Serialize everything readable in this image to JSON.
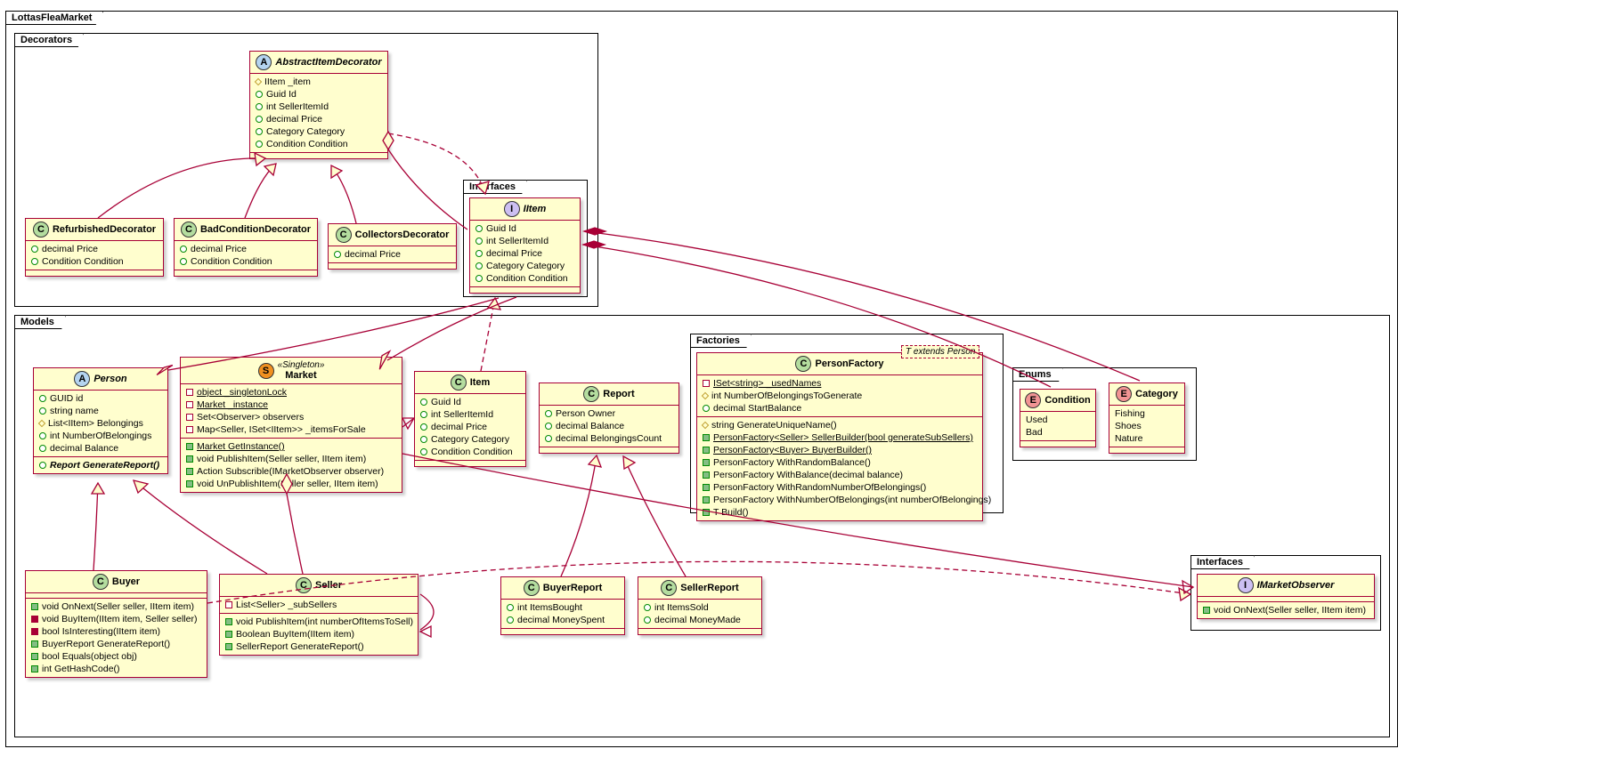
{
  "frames": {
    "root": "LottasFleaMarket",
    "decorators": "Decorators",
    "decInterfaces": "Interfaces",
    "models": "Models",
    "factories": "Factories",
    "enums": "Enums",
    "modInterfaces": "Interfaces"
  },
  "AbstractItemDecorator": {
    "name": "AbstractItemDecorator",
    "m0": "IItem _item",
    "m1": "Guid Id",
    "m2": "int SellerItemId",
    "m3": "decimal Price",
    "m4": "Category Category",
    "m5": "Condition Condition"
  },
  "RefurbishedDecorator": {
    "name": "RefurbishedDecorator",
    "m0": "decimal Price",
    "m1": "Condition Condition"
  },
  "BadConditionDecorator": {
    "name": "BadConditionDecorator",
    "m0": "decimal Price",
    "m1": "Condition Condition"
  },
  "CollectorsDecorator": {
    "name": "CollectorsDecorator",
    "m0": "decimal Price"
  },
  "IItem": {
    "name": "IItem",
    "m0": "Guid Id",
    "m1": "int SellerItemId",
    "m2": "decimal Price",
    "m3": "Category Category",
    "m4": "Condition Condition"
  },
  "Person": {
    "name": "Person",
    "m0": "GUID id",
    "m1": "string name",
    "m2": "List<IItem> Belongings",
    "m3": "int NumberOfBelongings",
    "m4": "decimal Balance",
    "m5": "Report GenerateReport()"
  },
  "Market": {
    "stereo": "«Singleton»",
    "name": "Market",
    "m0": "object _singletonLock",
    "m1": "Market _instance",
    "m2": "Set<Observer> observers",
    "m3": "Map<Seller, ISet<IItem>> _itemsForSale",
    "m4": "Market GetInstance()",
    "m5": "void PublishItem(Seller seller, IItem item)",
    "m6": "Action Subscrible(IMarketObserver observer)",
    "m7": "void UnPublishItem(Seller seller, IItem item)"
  },
  "Item": {
    "name": "Item",
    "m0": "Guid Id",
    "m1": "int SellerItemId",
    "m2": "decimal Price",
    "m3": "Category Category",
    "m4": "Condition Condition"
  },
  "Report": {
    "name": "Report",
    "m0": "Person Owner",
    "m1": "decimal Balance",
    "m2": "decimal BelongingsCount"
  },
  "PersonFactory": {
    "name": "PersonFactory",
    "tpl": "T extends Person",
    "m0": "ISet<string> _usedNames",
    "m1": "int NumberOfBelongingsToGenerate",
    "m2": "decimal StartBalance",
    "m3": "string GenerateUniqueName()",
    "m4": "PersonFactory<Seller> SellerBuilder(bool generateSubSellers)",
    "m5": "PersonFactory<Buyer> BuyerBuilder()",
    "m6": "PersonFactory WithRandomBalance()",
    "m7": "PersonFactory WithBalance(decimal balance)",
    "m8": "PersonFactory WithRandomNumberOfBelongings()",
    "m9": "PersonFactory WithNumberOfBelongings(int numberOfBelongings)",
    "m10": "T Build()"
  },
  "Condition": {
    "name": "Condition",
    "m0": "Used",
    "m1": "Bad"
  },
  "Category": {
    "name": "Category",
    "m0": "Fishing",
    "m1": "Shoes",
    "m2": "Nature"
  },
  "Buyer": {
    "name": "Buyer",
    "m0": "void OnNext(Seller seller, IItem item)",
    "m1": "void BuyItem(IItem item, Seller seller)",
    "m2": "bool IsInteresting(IItem item)",
    "m3": "BuyerReport GenerateReport()",
    "m4": "bool Equals(object obj)",
    "m5": "int GetHashCode()"
  },
  "Seller": {
    "name": "Seller",
    "m0": "List<Seller> _subSellers",
    "m1": "void PublishItem(int numberOfItemsToSell)",
    "m2": "Boolean BuyItem(IItem item)",
    "m3": "SellerReport GenerateReport()"
  },
  "BuyerReport": {
    "name": "BuyerReport",
    "m0": "int ItemsBought",
    "m1": "decimal MoneySpent"
  },
  "SellerReport": {
    "name": "SellerReport",
    "m0": "int ItemsSold",
    "m1": "decimal MoneyMade"
  },
  "IMarketObserver": {
    "name": "IMarketObserver",
    "m0": "void OnNext(Seller seller, IItem item)"
  }
}
